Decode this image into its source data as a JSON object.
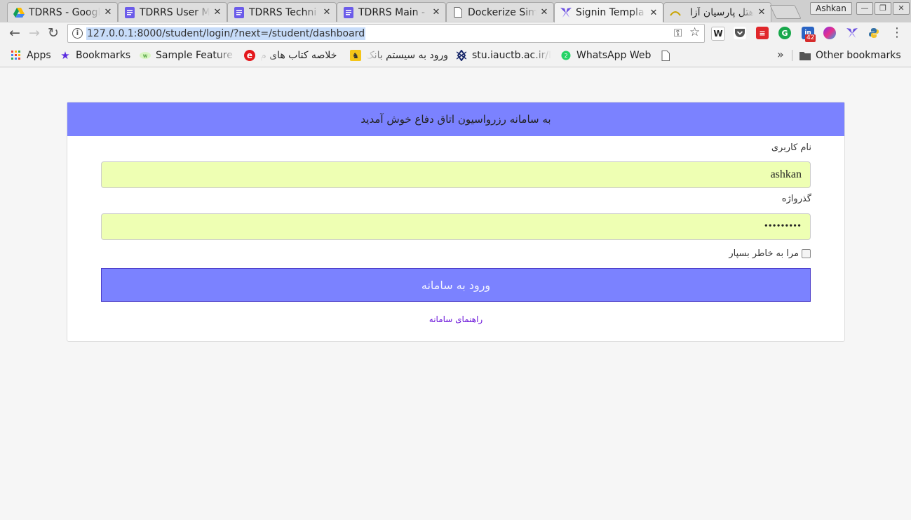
{
  "tabs": [
    {
      "title": "TDRRS - Google",
      "icon": "google-drive-icon"
    },
    {
      "title": "TDRRS User M",
      "icon": "google-docs-icon"
    },
    {
      "title": "TDRRS Techni",
      "icon": "google-docs-icon"
    },
    {
      "title": "TDRRS Main -",
      "icon": "google-docs-icon"
    },
    {
      "title": "Dockerize Sim",
      "icon": "page-icon"
    },
    {
      "title": "Signin Templa",
      "icon": "app-logo-icon",
      "active": true
    },
    {
      "title": "هتل پارسیان آزا",
      "icon": "hotel-favicon-icon"
    }
  ],
  "profile_name": "Ashkan",
  "url": "127.0.0.1:8000/student/login/?next=/student/dashboard",
  "badge_count": "42",
  "bookmarks": [
    {
      "label": "Apps",
      "icon": "apps-grid-icon"
    },
    {
      "label": "Bookmarks",
      "icon": "star-icon"
    },
    {
      "label": "Sample Feature I",
      "icon": "sample-feature-icon"
    },
    {
      "label": "خلاصه کتاب های م",
      "icon": "e-logo-icon"
    },
    {
      "label": "ورود به سیستم بانک",
      "icon": "bank-logo-icon"
    },
    {
      "label": "stu.iauctb.ac.ir/I",
      "icon": "university-logo-icon"
    },
    {
      "label": "WhatsApp Web",
      "icon": "whatsapp-icon"
    }
  ],
  "other_bookmarks": "Other bookmarks",
  "login": {
    "header": "به سامانه رزرواسیون اتاق دفاع خوش آمدید",
    "username_label": "نام کاربری",
    "username_value": "ashkan",
    "password_label": "گذرواژه",
    "password_mask": "•••••••••",
    "remember_label": "مرا به خاطر بسپار",
    "submit_label": "ورود به سامانه",
    "help_link": "راهنمای سامانه"
  },
  "colors": {
    "accent": "#7b82ff",
    "input_autofill": "#eeffb3",
    "link": "#6a14d9"
  }
}
